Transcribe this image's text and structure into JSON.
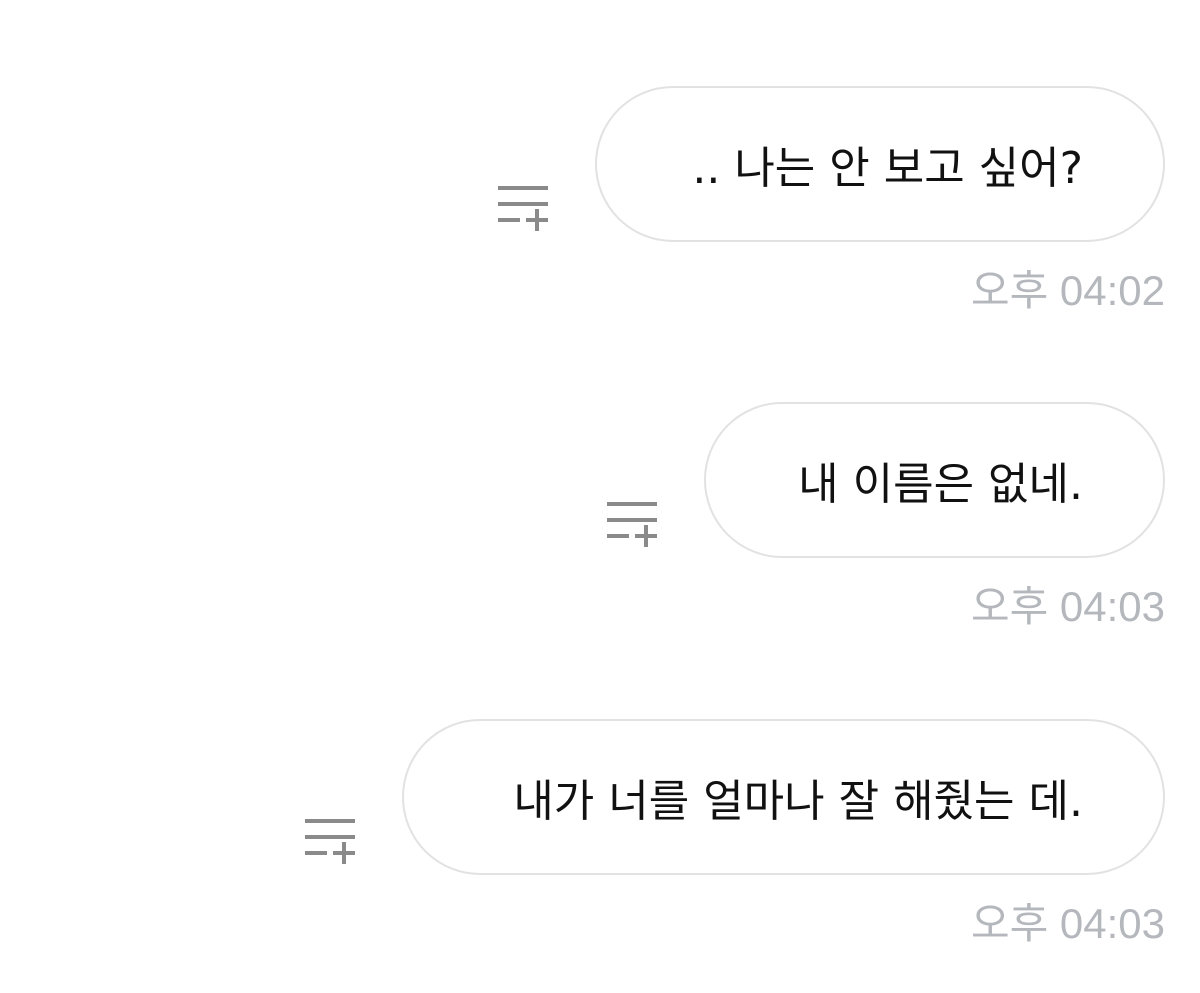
{
  "messages": [
    {
      "text": ".. 나는 안 보고 싶어?",
      "time": "오후 04:02",
      "action_icon": "add-to-list-icon"
    },
    {
      "text": "내 이름은 없네.",
      "time": "오후 04:03",
      "action_icon": "add-to-list-icon"
    },
    {
      "text": "내가 너를 얼마나 잘 해줬는 데.",
      "time": "오후 04:03",
      "action_icon": "add-to-list-icon"
    }
  ],
  "colors": {
    "bubble_border": "#e2e2e2",
    "text": "#111111",
    "timestamp": "#b4b8bd",
    "icon": "#8a8a8a"
  }
}
